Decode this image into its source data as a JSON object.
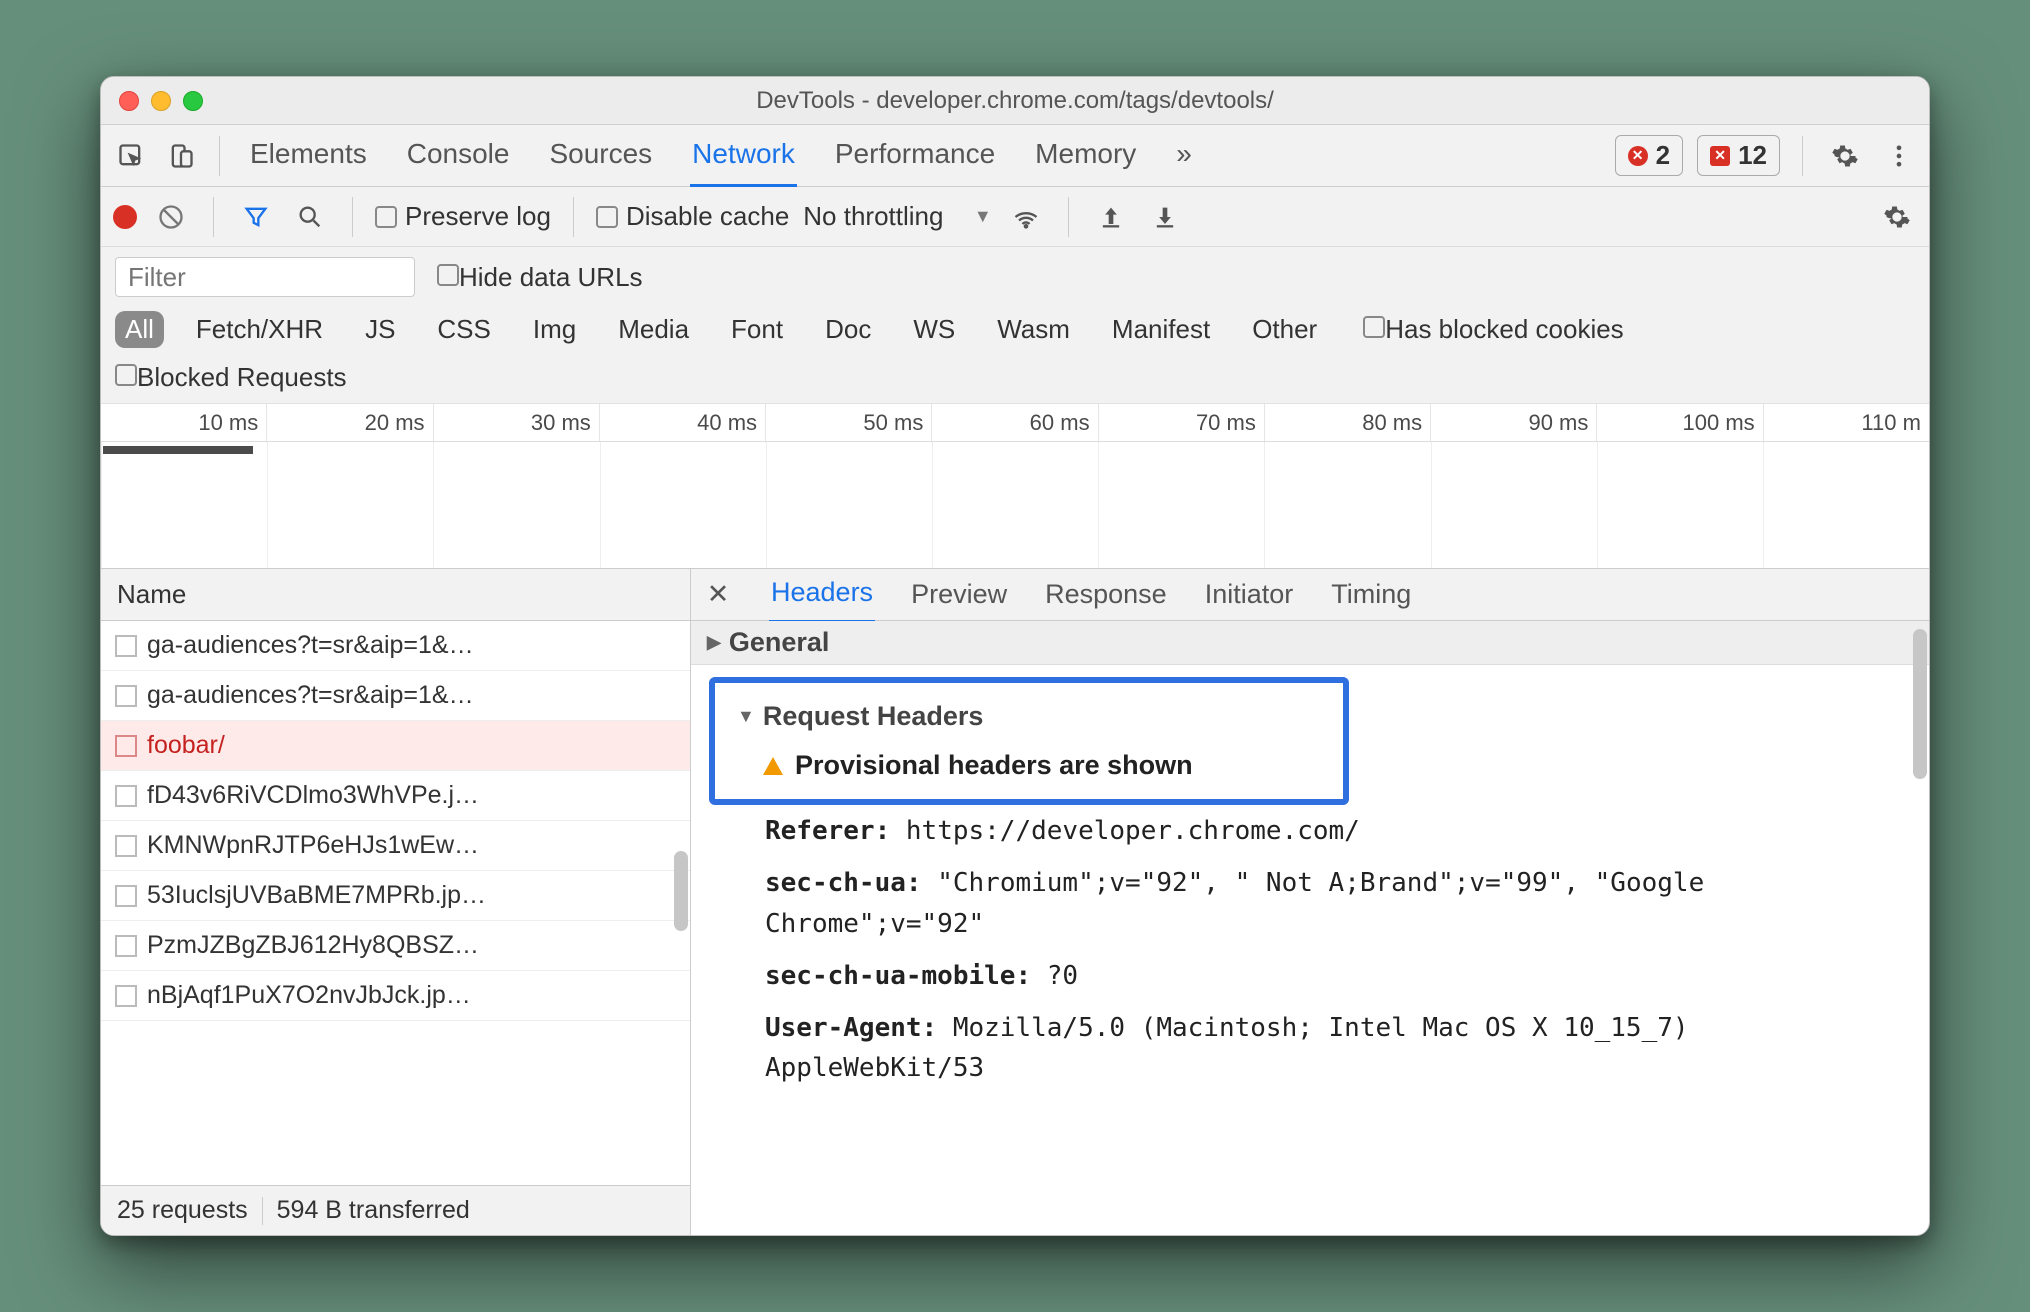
{
  "window": {
    "title": "DevTools - developer.chrome.com/tags/devtools/"
  },
  "tabs": {
    "items": [
      "Elements",
      "Console",
      "Sources",
      "Network",
      "Performance",
      "Memory"
    ],
    "active": "Network",
    "more": "»",
    "errors": "2",
    "issues": "12"
  },
  "toolbar": {
    "preserve": "Preserve log",
    "disable": "Disable cache",
    "throttling": "No throttling"
  },
  "filterbar": {
    "placeholder": "Filter",
    "hide": "Hide data URLs",
    "types": [
      "All",
      "Fetch/XHR",
      "JS",
      "CSS",
      "Img",
      "Media",
      "Font",
      "Doc",
      "WS",
      "Wasm",
      "Manifest",
      "Other"
    ],
    "blockedcookies": "Has blocked cookies",
    "blockedreq": "Blocked Requests"
  },
  "timeline": {
    "ticks": [
      "10 ms",
      "20 ms",
      "30 ms",
      "40 ms",
      "50 ms",
      "60 ms",
      "70 ms",
      "80 ms",
      "90 ms",
      "100 ms",
      "110 m"
    ]
  },
  "left": {
    "header": "Name",
    "rows": [
      {
        "name": "ga-audiences?t=sr&aip=1&…",
        "err": false
      },
      {
        "name": "ga-audiences?t=sr&aip=1&…",
        "err": false
      },
      {
        "name": "foobar/",
        "err": true
      },
      {
        "name": "fD43v6RiVCDlmo3WhVPe.j…",
        "err": false
      },
      {
        "name": "KMNWpnRJTP6eHJs1wEw…",
        "err": false
      },
      {
        "name": "53IuclsjUVBaBME7MPRb.jp…",
        "err": false
      },
      {
        "name": "PzmJZBgZBJ612Hy8QBSZ…",
        "err": false
      },
      {
        "name": "nBjAqf1PuX7O2nvJbJck.jp…",
        "err": false
      }
    ],
    "status": {
      "requests": "25 requests",
      "transferred": "594 B transferred"
    }
  },
  "detail": {
    "tabs": [
      "Headers",
      "Preview",
      "Response",
      "Initiator",
      "Timing"
    ],
    "active": "Headers",
    "general": "General",
    "reqheaders": "Request Headers",
    "provisional": "Provisional headers are shown",
    "headers": {
      "referer_key": "Referer:",
      "referer_val": "https://developer.chrome.com/",
      "secua_key": "sec-ch-ua:",
      "secua_val": "\"Chromium\";v=\"92\", \" Not A;Brand\";v=\"99\", \"Google Chrome\";v=\"92\"",
      "secmob_key": "sec-ch-ua-mobile:",
      "secmob_val": "?0",
      "ua_key": "User-Agent:",
      "ua_val": "Mozilla/5.0 (Macintosh; Intel Mac OS X 10_15_7) AppleWebKit/53"
    }
  }
}
